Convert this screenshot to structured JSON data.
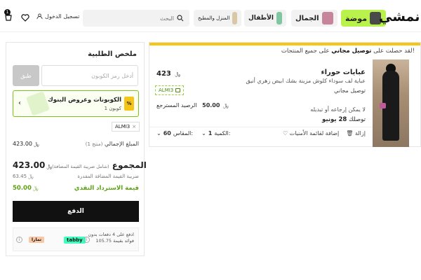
{
  "header": {
    "cart_count": "1",
    "login_label": "تسجيل الدخول",
    "search_placeholder": "البحث",
    "chip_home": "المنزل والمطبخ",
    "chip_kids": "الأطفال",
    "chip_beauty": "الجمال",
    "chip_fashion": "موضة",
    "logo": "نمشي",
    "colors": {
      "fashion_chip": "#b9f24a",
      "accent": "#f5c518"
    }
  },
  "cart_item": {
    "promo_prefix": "لقد حصلت على",
    "promo_bold": "توصيل مجاني",
    "promo_suffix": "على جميع المنتجات!",
    "title": "عبايات حوراء",
    "description": "عباية لف سوداء كلوش مزينة بشك ابيض زهري أنيق",
    "shipping": "توصيل مجاني",
    "price": "423",
    "coupon_code": "ALMI3",
    "savings_label": "الرصيد المسترجع",
    "savings_value": "50.00",
    "no_return": "لا يمكن إرجاعه أو تبديله",
    "delivery_prefix": "توصلك",
    "delivery_date": "28 يونيو",
    "remove_label": "إزالة",
    "wishlist_label": "إضافة لقائمة الأمنيات",
    "qty_label": "الكمية:",
    "qty_value": "1",
    "size_label": "المقاس:",
    "size_value": "60"
  },
  "summary": {
    "title": "ملخص الطلبية",
    "coupon_placeholder": "أدخل رمز الكوبون",
    "apply_label": "طبق",
    "bank_title": "الكوبونات وعروض البنوك",
    "bank_subtitle": "1 كوبون",
    "applied_code": "ALMI3",
    "subtotal_label": "المبلغ الإجمالي",
    "subtotal_items": "(1 منتج)",
    "subtotal_value": "423.00",
    "total_label": "المجموع",
    "total_note": "(شامل ضريبة القيمة المضافة)",
    "total_value": "423.00",
    "vat_label": "ضريبة القيمة المضافة المقدرة",
    "vat_value": "63.45",
    "cashback_label": "قيمة الاسترداد النقدي",
    "cashback_value": "50.00",
    "pay_label": "الدفع",
    "bnpl_line1": "ادفع على 4 دفعات بدون",
    "bnpl_line2": "فوائد بقيمة 105.75",
    "tabby": "tabby",
    "tamara": "تمارا"
  }
}
